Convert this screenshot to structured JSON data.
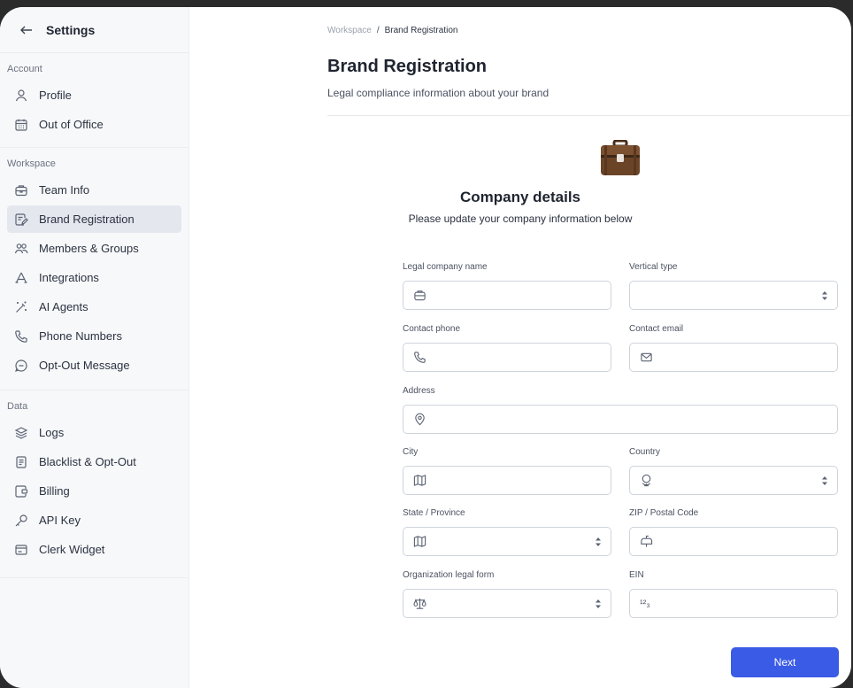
{
  "sidebar": {
    "title": "Settings",
    "sections": [
      {
        "title": "Account",
        "items": [
          {
            "label": "Profile",
            "icon": "user-icon"
          },
          {
            "label": "Out of Office",
            "icon": "calendar-icon"
          }
        ]
      },
      {
        "title": "Workspace",
        "items": [
          {
            "label": "Team Info",
            "icon": "briefcase-icon"
          },
          {
            "label": "Brand Registration",
            "icon": "file-edit-icon",
            "active": true
          },
          {
            "label": "Members & Groups",
            "icon": "users-icon"
          },
          {
            "label": "Integrations",
            "icon": "puzzle-icon"
          },
          {
            "label": "AI Agents",
            "icon": "magic-wand-icon"
          },
          {
            "label": "Phone Numbers",
            "icon": "phone-icon"
          },
          {
            "label": "Opt-Out Message",
            "icon": "message-stop-icon"
          }
        ]
      },
      {
        "title": "Data",
        "items": [
          {
            "label": "Logs",
            "icon": "layers-icon"
          },
          {
            "label": "Blacklist & Opt-Out",
            "icon": "list-icon"
          },
          {
            "label": "Billing",
            "icon": "wallet-icon"
          },
          {
            "label": "API Key",
            "icon": "key-icon"
          },
          {
            "label": "Clerk Widget",
            "icon": "widget-icon"
          }
        ]
      }
    ]
  },
  "breadcrumb": {
    "parent": "Workspace",
    "separator": "/",
    "current": "Brand Registration"
  },
  "page": {
    "title": "Brand Registration",
    "subtitle": "Legal compliance information about your brand"
  },
  "card": {
    "title": "Company details",
    "subtitle": "Please update your company information below"
  },
  "fields": {
    "legal_name": {
      "label": "Legal company name"
    },
    "vertical": {
      "label": "Vertical type"
    },
    "phone": {
      "label": "Contact phone"
    },
    "email": {
      "label": "Contact email"
    },
    "address": {
      "label": "Address"
    },
    "city": {
      "label": "City"
    },
    "country": {
      "label": "Country"
    },
    "state": {
      "label": "State / Province"
    },
    "zip": {
      "label": "ZIP / Postal Code"
    },
    "org_form": {
      "label": "Organization legal form"
    },
    "ein": {
      "label": "EIN",
      "icon_text": "¹²₃"
    }
  },
  "actions": {
    "next": "Next"
  },
  "colors": {
    "accent": "#3a5be5",
    "sidebar_bg": "#f7f8fa",
    "active_item": "#e4e7ee"
  }
}
